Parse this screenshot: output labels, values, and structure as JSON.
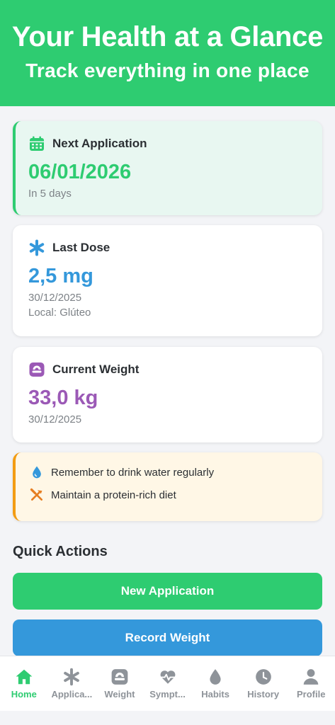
{
  "hero": {
    "title": "Your Health at a Glance",
    "subtitle": "Track everything in one place"
  },
  "next_application": {
    "icon": "calendar-icon",
    "title": "Next Application",
    "date": "06/01/2026",
    "countdown": "In 5 days"
  },
  "last_dose": {
    "icon": "asterisk-icon",
    "title": "Last Dose",
    "amount": "2,5 mg",
    "date": "30/12/2025",
    "site": "Local: Glúteo"
  },
  "current_weight": {
    "icon": "kettlebell-icon",
    "title": "Current Weight",
    "value": "33,0 kg",
    "date": "30/12/2025"
  },
  "tips": [
    {
      "icon": "water-drop-icon",
      "text": "Remember to drink water regularly"
    },
    {
      "icon": "utensils-icon",
      "text": "Maintain a protein-rich diet"
    }
  ],
  "quick_actions": {
    "title": "Quick Actions",
    "new_application": "New Application",
    "record_weight": "Record Weight"
  },
  "tabs": [
    {
      "label": "Home",
      "icon": "home-icon",
      "active": true
    },
    {
      "label": "Applica...",
      "icon": "asterisk-icon",
      "active": false
    },
    {
      "label": "Weight",
      "icon": "scale-icon",
      "active": false
    },
    {
      "label": "Sympt...",
      "icon": "heartbeat-icon",
      "active": false
    },
    {
      "label": "Habits",
      "icon": "water-drop-icon",
      "active": false
    },
    {
      "label": "History",
      "icon": "clock-icon",
      "active": false
    },
    {
      "label": "Profile",
      "icon": "user-icon",
      "active": false
    }
  ],
  "colors": {
    "primary": "#2ecc71",
    "blue": "#3498db",
    "purple": "#9b59b6",
    "orange": "#f39c12"
  }
}
